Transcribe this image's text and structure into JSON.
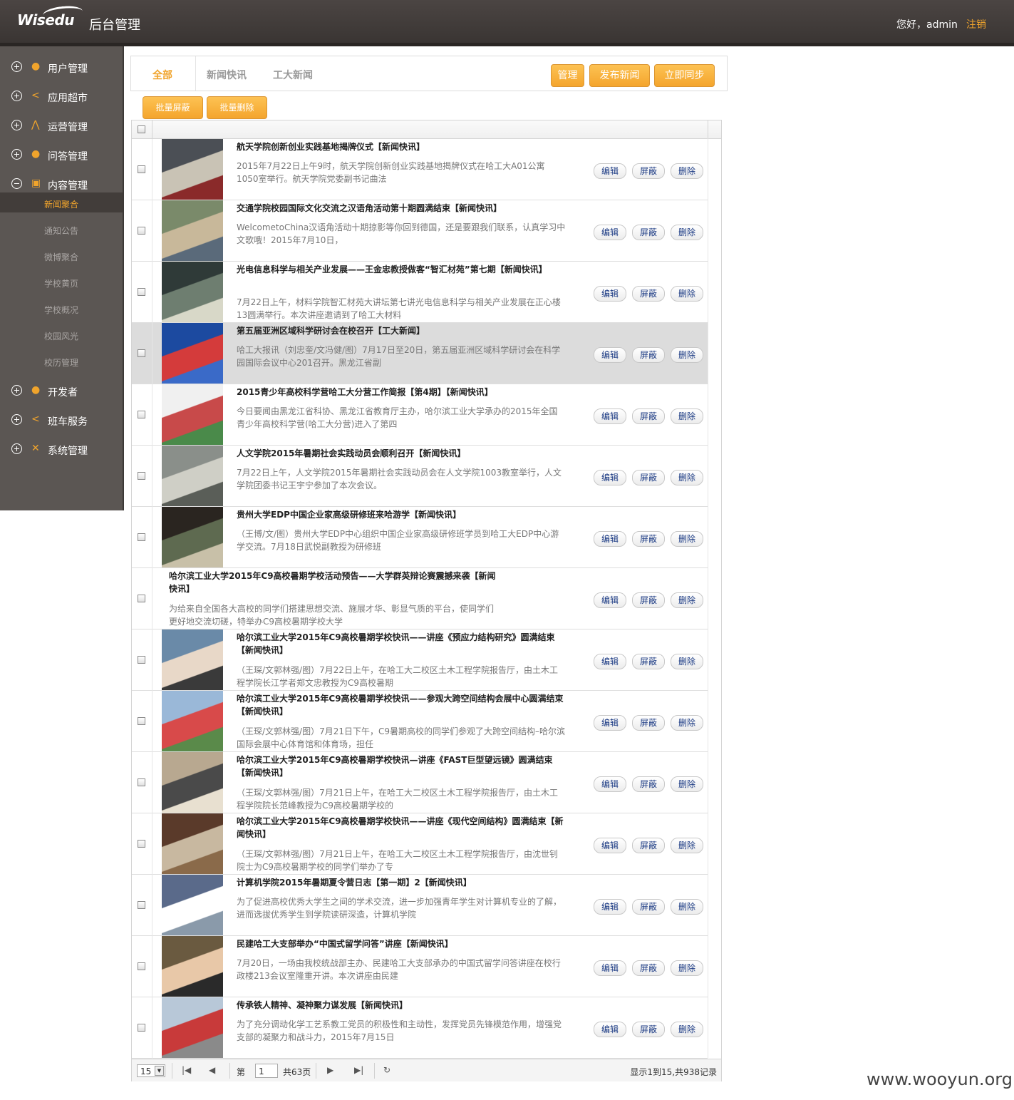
{
  "header": {
    "logo_text": "Wisedu",
    "app_name": "后台管理",
    "greeting": "您好，admin",
    "logout_label": "注销"
  },
  "sidebar": {
    "menus": [
      {
        "label": "用户管理",
        "icon": "user-icon",
        "expanded": false
      },
      {
        "label": "应用超市",
        "icon": "share-icon",
        "expanded": false
      },
      {
        "label": "运营管理",
        "icon": "chart-icon",
        "expanded": false
      },
      {
        "label": "问答管理",
        "icon": "user-icon",
        "expanded": false
      },
      {
        "label": "内容管理",
        "icon": "document-icon",
        "expanded": true
      },
      {
        "label": "开发者",
        "icon": "user-icon",
        "expanded": false
      },
      {
        "label": "班车服务",
        "icon": "share-icon",
        "expanded": false
      },
      {
        "label": "系统管理",
        "icon": "tools-icon",
        "expanded": false
      }
    ],
    "sub_items": [
      "新闻聚合",
      "通知公告",
      "微博聚合",
      "学校黄页",
      "学校概况",
      "校园风光",
      "校历管理"
    ],
    "active_sub": "新闻聚合"
  },
  "tabs": {
    "items": [
      "全部",
      "新闻快讯",
      "工大新闻"
    ],
    "active": "全部",
    "actions": [
      "管理",
      "发布新闻",
      "立即同步"
    ]
  },
  "bulk_actions": [
    "批量屏蔽",
    "批量删除"
  ],
  "row_actions": {
    "edit": "编辑",
    "hide": "屏蔽",
    "delete": "删除"
  },
  "news": [
    {
      "title": "航天学院创新创业实践基地揭牌仪式【新闻快讯】",
      "summary": "2015年7月22日上午9时，航天学院创新创业实践基地揭牌仪式在哈工大A01公寓1050室举行。航天学院党委副书记曲法"
    },
    {
      "title": "交通学院校园国际文化交流之汉语角活动第十期圆满结束【新闻快讯】",
      "summary": "WelcometoChina汉语角活动十期掠影等你回到德国，还是要跟我们联系，认真学习中文歌哦！2015年7月10日，"
    },
    {
      "title": "光电信息科学与相关产业发展——王金忠教授做客“智汇材苑”第七期【新闻快讯】",
      "summary": "7月22日上午，材料学院智汇材苑大讲坛第七讲光电信息科学与相关产业发展在正心楼13圆满举行。本次讲座邀请到了哈工大材料"
    },
    {
      "title": "第五届亚洲区域科学研讨会在校召开【工大新闻】",
      "summary": "哈工大报讯（刘忠奎/文冯健/图）7月17日至20日，第五届亚洲区域科学研讨会在科学园国际会议中心201召开。黑龙江省副"
    },
    {
      "title": "2015青少年高校科学营哈工大分营工作简报【第4期】【新闻快讯】",
      "summary": "今日要闻由黑龙江省科协、黑龙江省教育厅主办，哈尔滨工业大学承办的2015年全国青少年高校科学营(哈工大分营)进入了第四"
    },
    {
      "title": "人文学院2015年暑期社会实践动员会顺利召开【新闻快讯】",
      "summary": "7月22日上午，人文学院2015年暑期社会实践动员会在人文学院1003教室举行，人文学院团委书记王宇宁参加了本次会议。"
    },
    {
      "title": "贵州大学EDP中国企业家高级研修班来哈游学【新闻快讯】",
      "summary": "（王博/文/图）贵州大学EDP中心组织中国企业家高级研修班学员到哈工大EDP中心游学交流。7月18日武悦副教授为研修班"
    },
    {
      "title": "哈尔滨工业大学2015年C9高校暑期学校活动预告——大学群英辩论赛震撼来袭【新闻快讯】",
      "summary": "为给来自全国各大高校的同学们搭建思想交流、施展才华、彰显气质的平台，使同学们更好地交流切磋，特举办C9高校暑期学校大学"
    },
    {
      "title": "哈尔滨工业大学2015年C9高校暑期学校快讯——讲座《预应力结构研究》圆满结束【新闻快讯】",
      "summary": "（王琛/文郭林强/图）7月22日上午，在哈工大二校区土木工程学院报告厅，由土木工程学院长江学者郑文忠教授为C9高校暑期"
    },
    {
      "title": "哈尔滨工业大学2015年C9高校暑期学校快讯——参观大跨空间结构会展中心圆满结束【新闻快讯】",
      "summary": "（王琛/文郭林强/图）7月21日下午，C9暑期高校的同学们参观了大跨空间结构–哈尔滨国际会展中心体育馆和体育场，担任"
    },
    {
      "title": "哈尔滨工业大学2015年C9高校暑期学校快讯—讲座《FAST巨型望远镜》圆满结束【新闻快讯】",
      "summary": "（王琛/文郭林强/图）7月21日上午，在哈工大二校区土木工程学院报告厅，由土木工程学院院长范峰教授为C9高校暑期学校的"
    },
    {
      "title": "哈尔滨工业大学2015年C9高校暑期学校快讯——讲座《现代空间结构》圆满结束【新闻快讯】",
      "summary": "（王琛/文郭林强/图）7月21日上午，在哈工大二校区土木工程学院报告厅，由沈世钊院士为C9高校暑期学校的同学们举办了专"
    },
    {
      "title": "计算机学院2015年暑期夏令营日志【第一期】2【新闻快讯】",
      "summary": "为了促进高校优秀大学生之间的学术交流，进一步加强青年学生对计算机专业的了解，进而选拔优秀学生到学院读研深造，计算机学院"
    },
    {
      "title": "民建哈工大支部举办“中国式留学问答”讲座【新闻快讯】",
      "summary": "7月20日，一场由我校统战部主办、民建哈工大支部承办的中国式留学问答讲座在校行政楼213会议室隆重开讲。本次讲座由民建"
    },
    {
      "title": "传承铁人精神、凝神聚力谋发展【新闻快讯】",
      "summary": "为了充分调动化学工艺系教工党员的积极性和主动性，发挥党员先锋模范作用，增强党支部的凝聚力和战斗力，2015年7月15日"
    }
  ],
  "pager": {
    "page_size": "15",
    "page_prefix": "第",
    "current_page": "1",
    "total_pages": "共63页",
    "info": "显示1到15,共938记录"
  },
  "watermark": "www.wooyun.org",
  "colors": {
    "accent": "#f0a42c",
    "header_bg": "#403b39",
    "sidebar_bg": "#5b5653",
    "link": "#1c3b84",
    "highlight_row": "#dcdcdc"
  }
}
